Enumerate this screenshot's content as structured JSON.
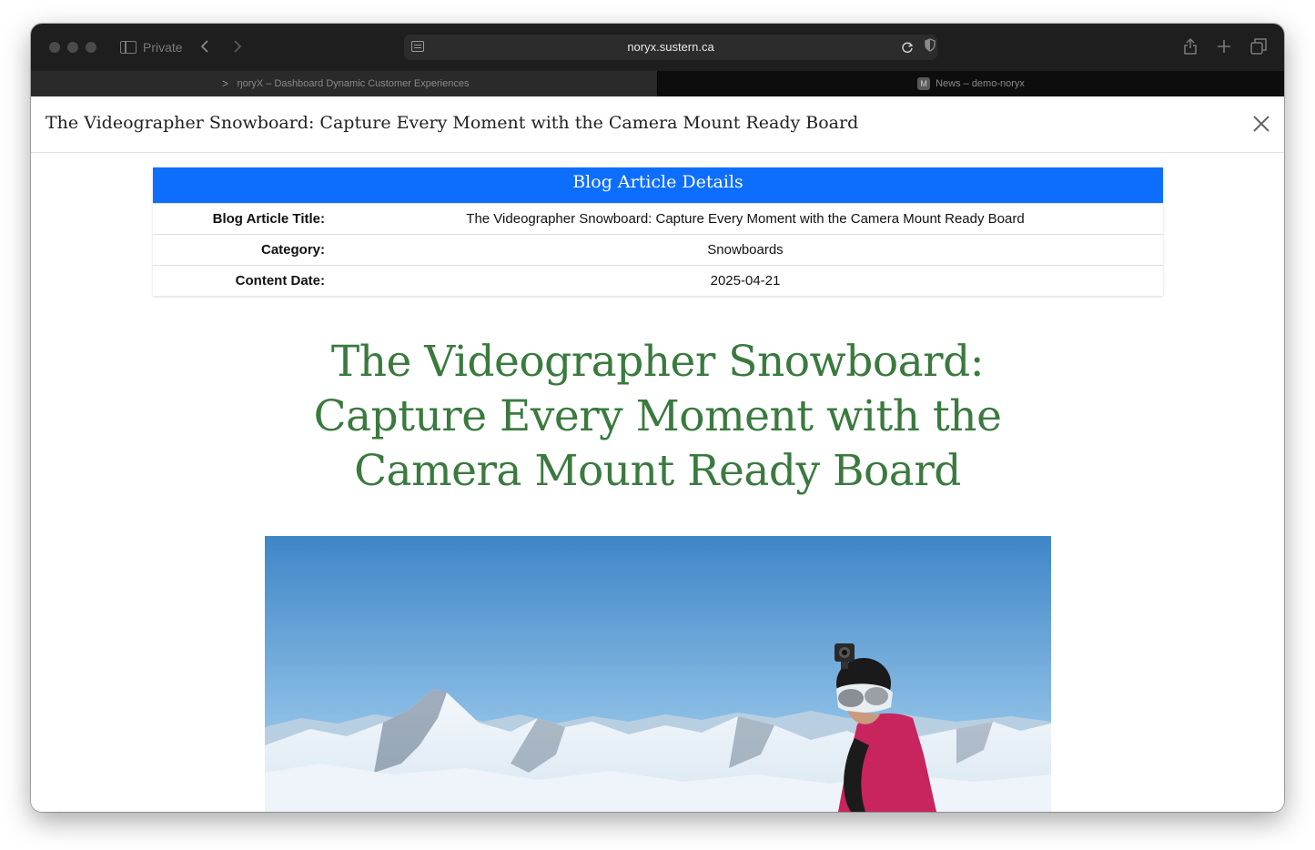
{
  "browser": {
    "private_label": "Private",
    "url": "noryx.sustern.ca",
    "tabs": [
      {
        "label": "ŋoryX – Dashboard Dynamic Customer Experiences"
      },
      {
        "label": "News – demo-noryx",
        "favicon": "M"
      }
    ]
  },
  "modal": {
    "title": "The Videographer Snowboard: Capture Every Moment with the Camera Mount Ready Board"
  },
  "details": {
    "header": "Blog Article Details",
    "rows": [
      {
        "key": "Blog Article Title:",
        "value": "The Videographer Snowboard: Capture Every Moment with the Camera Mount Ready Board"
      },
      {
        "key": "Category:",
        "value": "Snowboards"
      },
      {
        "key": "Content Date:",
        "value": "2025-04-21"
      }
    ]
  },
  "article": {
    "heading_lines": [
      "The Videographer Snowboard:",
      "Capture Every Moment with the",
      "Camera Mount Ready Board"
    ],
    "heading_color": "#3a7a3e",
    "accent_color": "#0d6efd"
  }
}
